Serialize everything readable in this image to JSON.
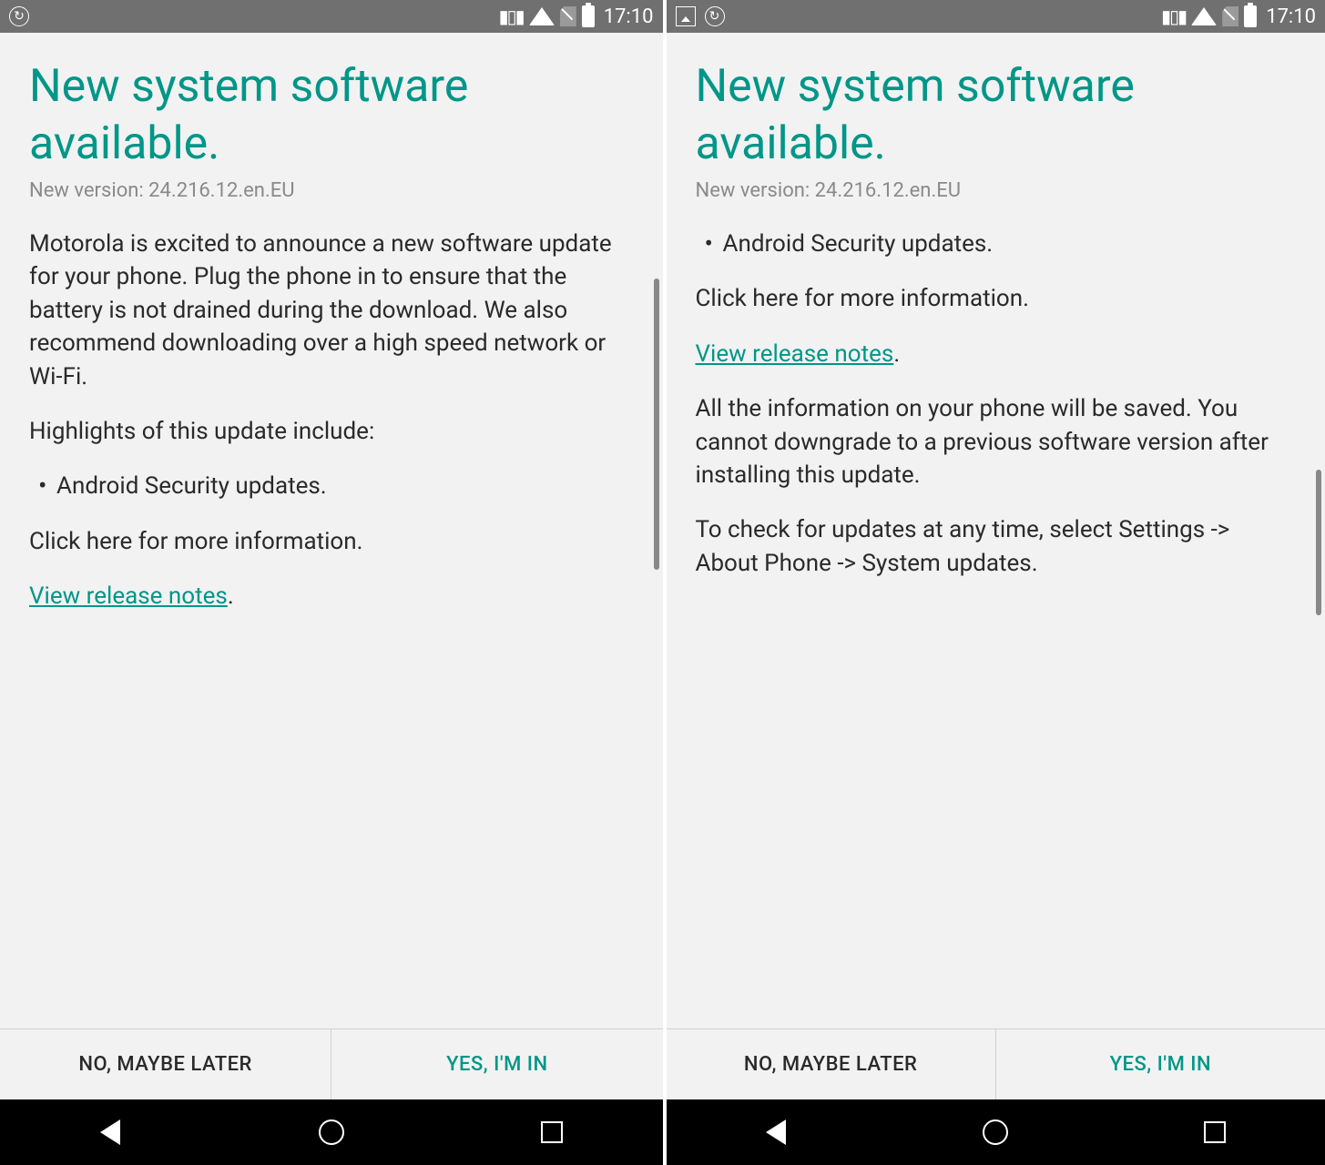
{
  "status": {
    "time": "17:10"
  },
  "accent_color": "#009688",
  "left": {
    "title": "New system software available.",
    "version": "New version: 24.216.12.en.EU",
    "intro": "Motorola is excited to announce a new software update for your phone. Plug the phone in to ensure that the battery is not drained during the download. We also recommend downloading over a high speed network or Wi-Fi.",
    "highlights_label": "Highlights of this update include:",
    "bullet1": "Android Security updates.",
    "click_here": "Click here for more information.",
    "release_link": "View release notes",
    "period": "."
  },
  "right": {
    "title": "New system software available.",
    "version": "New version: 24.216.12.en.EU",
    "bullet1": "Android Security updates.",
    "click_here": "Click here for more information.",
    "release_link": "View release notes",
    "period": ".",
    "save_info": "All the information on your phone will be saved. You cannot downgrade to a previous software version after installing this update.",
    "check_info": "To check for updates at any time, select Settings -> About Phone -> System updates."
  },
  "buttons": {
    "no": "NO, MAYBE LATER",
    "yes": "YES, I'M IN"
  }
}
